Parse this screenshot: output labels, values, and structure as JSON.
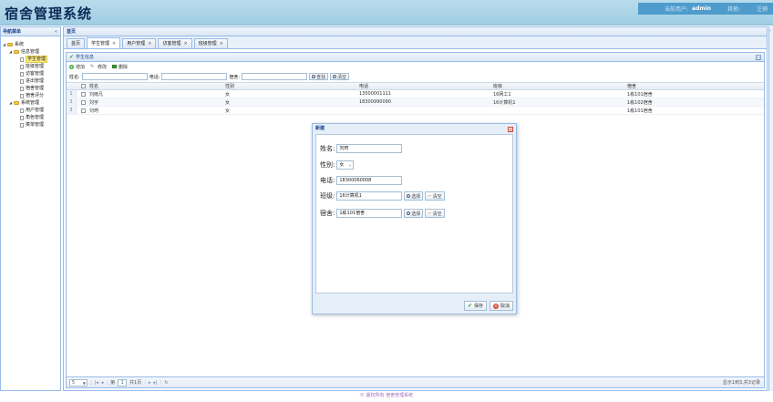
{
  "app": {
    "title": "宿舍管理系统"
  },
  "user_bar": {
    "prefix": "当前用户:",
    "username": "admin",
    "other_label": "其他:",
    "logout_label": "注销"
  },
  "nav": {
    "title": "导航菜单",
    "items": [
      {
        "label": "系统",
        "type": "folder",
        "level": 0
      },
      {
        "label": "信息管理",
        "type": "folder",
        "level": 1
      },
      {
        "label": "学生管理",
        "type": "file",
        "level": 2,
        "selected": true
      },
      {
        "label": "班级管理",
        "type": "file",
        "level": 2
      },
      {
        "label": "访客管理",
        "type": "file",
        "level": 2
      },
      {
        "label": "进出管理",
        "type": "file",
        "level": 2
      },
      {
        "label": "宿舍管理",
        "type": "file",
        "level": 2
      },
      {
        "label": "宿舍评分",
        "type": "file",
        "level": 2
      },
      {
        "label": "系统管理",
        "type": "folder",
        "level": 1
      },
      {
        "label": "用户管理",
        "type": "file",
        "level": 2
      },
      {
        "label": "角色管理",
        "type": "file",
        "level": 2
      },
      {
        "label": "菜单管理",
        "type": "file",
        "level": 2
      }
    ]
  },
  "main": {
    "title": "首页",
    "tabs": [
      {
        "label": "首页",
        "closable": false,
        "active": false
      },
      {
        "label": "学生管理",
        "closable": true,
        "active": true
      },
      {
        "label": "用户管理",
        "closable": true,
        "active": false
      },
      {
        "label": "访客管理",
        "closable": true,
        "active": false
      },
      {
        "label": "班级管理",
        "closable": true,
        "active": false
      }
    ]
  },
  "grid": {
    "title": "学生信息",
    "toolbar": {
      "add": "增加",
      "edit": "修改",
      "delete": "删除"
    },
    "search": {
      "name_label": "姓名:",
      "phone_label": "电话:",
      "dorm_label": "宿舍:",
      "find": "查找",
      "clear": "清空"
    },
    "columns": {
      "name": "姓名",
      "sex": "性别",
      "phone": "电话",
      "class": "班级",
      "dorm": "宿舍"
    },
    "rows": [
      {
        "num": "1",
        "name": "刘雨凡",
        "sex": "女",
        "phone": "13500001111",
        "class": "16网工1",
        "dorm": "1栋101宿舍"
      },
      {
        "num": "2",
        "name": "刘宇",
        "sex": "女",
        "phone": "18300990090",
        "class": "16计算机1",
        "dorm": "1栋102宿舍"
      },
      {
        "num": "3",
        "name": "刘珂",
        "sex": "女",
        "phone": "",
        "class": "",
        "dorm": "1栋101宿舍"
      }
    ],
    "pager": {
      "page_size": "5",
      "page_label": "第",
      "page": "1",
      "total_pages": "共1页",
      "info": "显示1到3,共3记录"
    }
  },
  "dialog": {
    "title": "新建",
    "name_label": "姓名:",
    "name_value": "刘珂",
    "sex_label": "性别:",
    "sex_value": "女",
    "phone_label": "电话:",
    "phone_value": "18300060008",
    "class_label": "班级:",
    "class_value": "16计算机1",
    "dorm_label": "宿舍:",
    "dorm_value": "1栋101宿舍",
    "select": "选择",
    "clear": "清空",
    "save": "保存",
    "cancel": "取消"
  },
  "footer": {
    "text": "© 版权所有 宿舍管理系统"
  },
  "colors": {
    "header_bg": "#9fcde3",
    "user_bar_bg": "#4f9ccc",
    "border": "#99bbe8",
    "title_text": "#0b2a55"
  }
}
